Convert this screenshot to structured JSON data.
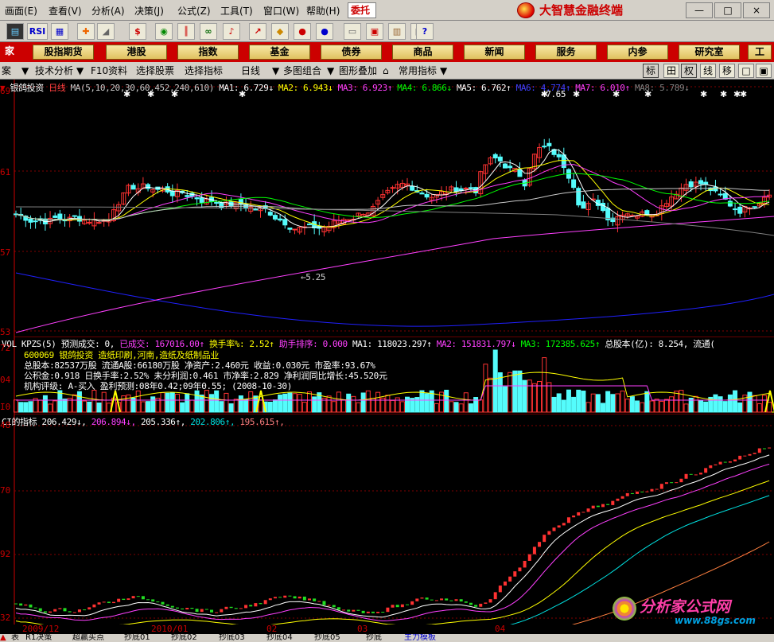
{
  "menu": {
    "items": [
      "画面(E)",
      "查看(V)",
      "分析(A)",
      "决策(J)",
      "公式(Z)",
      "工具(T)",
      "窗口(W)",
      "帮助(H)"
    ],
    "trade": "委托",
    "brand": "大智慧金融终端",
    "win": [
      "—",
      "□",
      "×"
    ]
  },
  "toolbar": {
    "icons": [
      "print-icon",
      "rsi-icon",
      "grid-icon",
      "crosshair-icon",
      "ruler-icon",
      "dollar-icon",
      "eye-icon",
      "bars-icon",
      "binoculars-icon",
      "alarm-icon",
      "chart-up-icon",
      "diamond-icon",
      "red-coin-icon",
      "blue-coin-icon",
      "notes-icon",
      "note2-icon",
      "book-icon",
      "grid2-icon",
      "help-icon"
    ],
    "rsi_label": "RSI"
  },
  "nav": {
    "items": [
      "股指期货",
      "港股",
      "指数",
      "基金",
      "债券",
      "商品",
      "新闻",
      "服务",
      "内参",
      "研究室",
      "工"
    ],
    "left": "家"
  },
  "subtool": {
    "left": "案",
    "items": [
      "技术分析",
      "F10资料",
      "选择股票",
      "选择指标",
      "日线",
      "多图组合",
      "图形叠加",
      "常用指标"
    ],
    "right": [
      "标",
      "田",
      "权",
      "线",
      "移",
      "□",
      "▣"
    ]
  },
  "price": {
    "name": "银鸽投资",
    "period": "日线",
    "ma_def": "MA(5,10,20,30,60,452,240,610)",
    "ma": [
      {
        "k": "MA1",
        "v": "6.729",
        "d": "↓",
        "c": "#ffffff"
      },
      {
        "k": "MA2",
        "v": "6.943",
        "d": "↓",
        "c": "#ffff00"
      },
      {
        "k": "MA3",
        "v": "6.923",
        "d": "↑",
        "c": "#ff40ff"
      },
      {
        "k": "MA4",
        "v": "6.866",
        "d": "↓",
        "c": "#00ff00"
      },
      {
        "k": "MA5",
        "v": "6.762",
        "d": "↑",
        "c": "#ffffff"
      },
      {
        "k": "MA6",
        "v": "4.774",
        "d": "↑",
        "c": "#4040ff"
      },
      {
        "k": "MA7",
        "v": "6.010",
        "d": "↑",
        "c": "#ff40ff"
      },
      {
        "k": "MA8",
        "v": "5.789",
        "d": "↓",
        "c": "#808080"
      }
    ],
    "axis": [
      "69",
      "61",
      "57",
      "53"
    ],
    "low_label": "5.25",
    "high_label": "7.65"
  },
  "vol": {
    "title": "VOL KPZS(5)",
    "pred": "预测成交: 0,",
    "done": "已成交: 167016.00↑",
    "turn": "换手率%: 2.52↑",
    "rank": "助手排序: 0.000",
    "ma1": "MA1: 118023.297↑",
    "ma2": "MA2: 151831.797↓",
    "ma3": "MA3: 172385.625↑",
    "cap": "总股本(亿): 8.254,",
    "float": "流通(",
    "axis": [
      "72",
      "04",
      "I0"
    ]
  },
  "fund": {
    "line1": "600069 银鸽投资 造纸印刷,河南,造纸及纸制品业",
    "line2": "总股本:82537万股 流通A股:66180万股 净资产:2.460元 收益:0.030元 市盈率:93.67%",
    "line3": "公积金:0.918  日换手率:2.52%  未分利润:0.461  市净率:2.829  净利润同比增长:45.520元",
    "line4": "机构评级: A-买入 盈利预测:08年0.42;09年0.55; (2008-10-30)"
  },
  "ci": {
    "title": "CI的指标",
    "vals": [
      {
        "v": "206.429",
        "d": "↓",
        "c": "#ffffff"
      },
      {
        "v": "206.894",
        "d": "↓",
        "c": "#ff40ff"
      },
      {
        "v": "205.336",
        "d": "↑",
        "c": "#ffffff"
      },
      {
        "v": "202.806",
        "d": "↑",
        "c": "#00e0e0"
      },
      {
        "v": "195.615",
        "d": "↑",
        "c": "#ff8080"
      }
    ],
    "axis": [
      "48",
      "70",
      "92",
      "32"
    ]
  },
  "dates": [
    "2009/12",
    "2010/01",
    "02",
    "03",
    "04"
  ],
  "bottom": [
    "表",
    "R1决策",
    "超赢买点",
    "抄底01",
    "抄底02",
    "抄底03",
    "抄底04",
    "抄底05",
    "抄底",
    "主力模板"
  ],
  "watermark": {
    "title": "分析家公式网",
    "url": "www.88gs.com"
  },
  "colors": {
    "up": "#ff3232",
    "down": "#54fcfc",
    "grid": "#800000",
    "axis": "#c00000"
  }
}
